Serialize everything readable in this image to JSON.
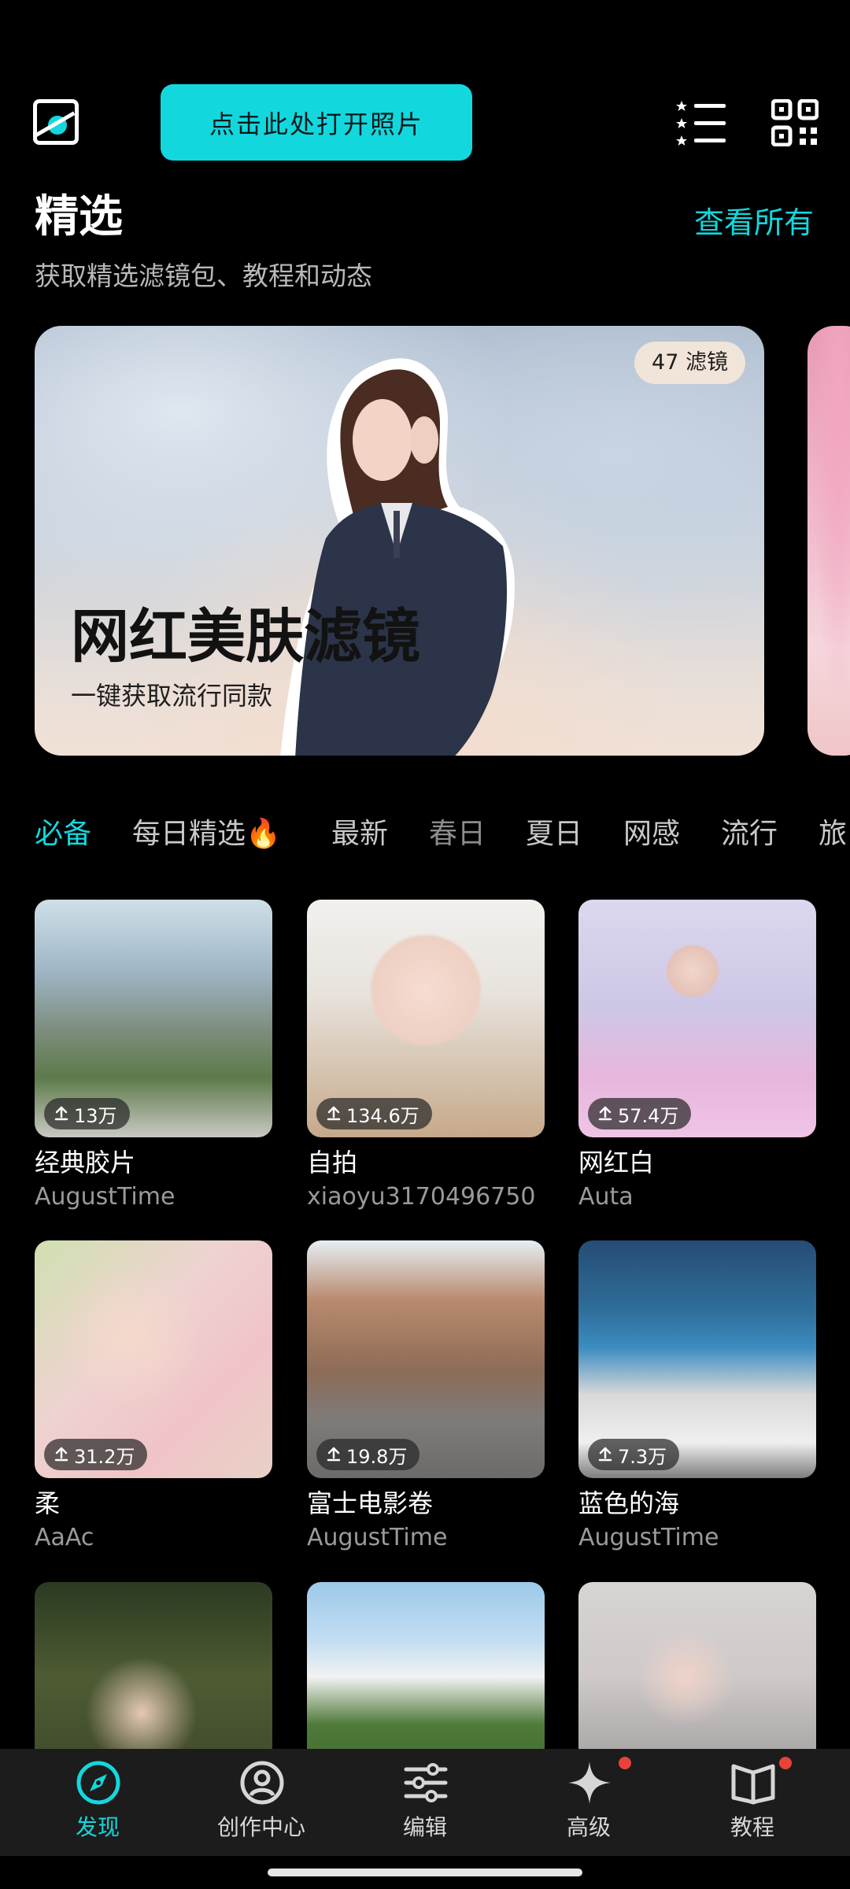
{
  "header": {
    "open_photo_label": "点击此处打开照片"
  },
  "featured": {
    "title": "精选",
    "view_all": "查看所有",
    "subtitle": "获取精选滤镜包、教程和动态"
  },
  "banner": {
    "badge": "47 滤镜",
    "title": "网红美肤滤镜",
    "subtitle": "一键获取流行同款"
  },
  "tabs": [
    {
      "label": "必备",
      "active": true
    },
    {
      "label": "每日精选🔥",
      "active": false
    },
    {
      "label": "最新",
      "active": false
    },
    {
      "label": "春日",
      "active": false
    },
    {
      "label": "夏日",
      "active": false
    },
    {
      "label": "网感",
      "active": false
    },
    {
      "label": "流行",
      "active": false
    },
    {
      "label": "旅",
      "active": false
    }
  ],
  "filters": [
    {
      "name": "经典胶片",
      "author": "AugustTime",
      "downloads": "13万"
    },
    {
      "name": "自拍",
      "author": "xiaoyu3170496750",
      "downloads": "134.6万"
    },
    {
      "name": "网红白",
      "author": "Auta",
      "downloads": "57.4万"
    },
    {
      "name": "柔",
      "author": "AaAc",
      "downloads": "31.2万"
    },
    {
      "name": "富士电影卷",
      "author": "AugustTime",
      "downloads": "19.8万"
    },
    {
      "name": "蓝色的海",
      "author": "AugustTime",
      "downloads": "7.3万"
    }
  ],
  "bottom_nav": [
    {
      "label": "发现",
      "icon": "compass-icon",
      "active": true
    },
    {
      "label": "创作中心",
      "icon": "profile-icon",
      "active": false
    },
    {
      "label": "编辑",
      "icon": "sliders-icon",
      "active": false
    },
    {
      "label": "高级",
      "icon": "sparkle-icon",
      "active": false,
      "badge": true
    },
    {
      "label": "教程",
      "icon": "book-icon",
      "active": false,
      "badge": true
    }
  ],
  "colors": {
    "accent": "#12d8de",
    "background": "#000000",
    "nav_background": "#1c1c1c",
    "notification": "#e8423a"
  }
}
